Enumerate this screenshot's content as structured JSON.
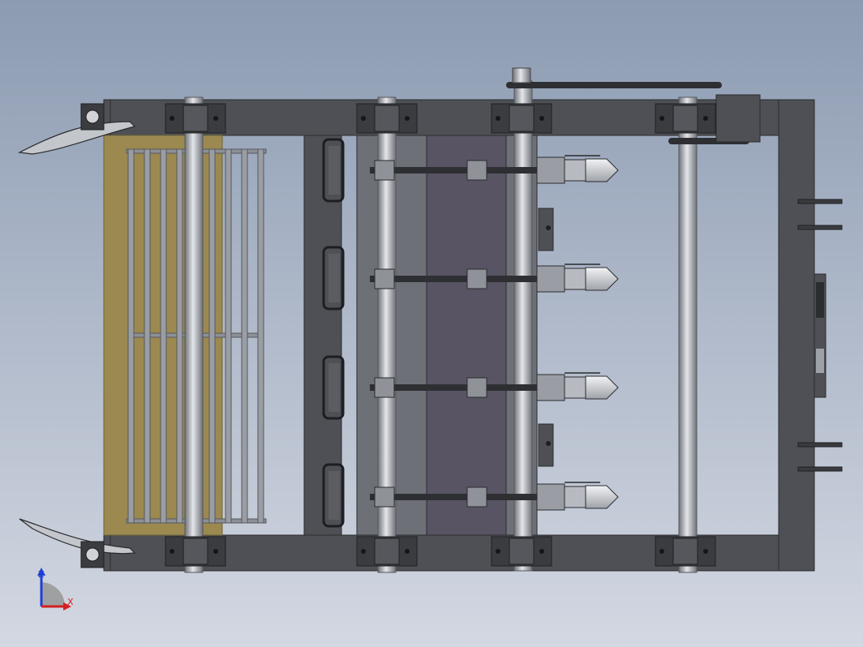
{
  "viewport": {
    "background_top": "#8c9bb2",
    "background_bottom": "#d3d8e2"
  },
  "model": {
    "frame_color": "#4e5055",
    "frame_edge": "#2a2b2e",
    "hopper_color": "#9b8950",
    "hopper_edge": "#6e6237",
    "belt_color": "#585464",
    "plate_color": "#6d7077",
    "shaft_color": "#b9bcc2",
    "chain_color": "#2e2f33",
    "blade_color": "#d7d9dd",
    "bearing_color": "#3b3c40"
  },
  "triad": {
    "z_label": "Z",
    "x_label": "X",
    "z_color": "#1f3fd6",
    "x_color": "#d42020",
    "y_color": "#9a9a9a"
  }
}
